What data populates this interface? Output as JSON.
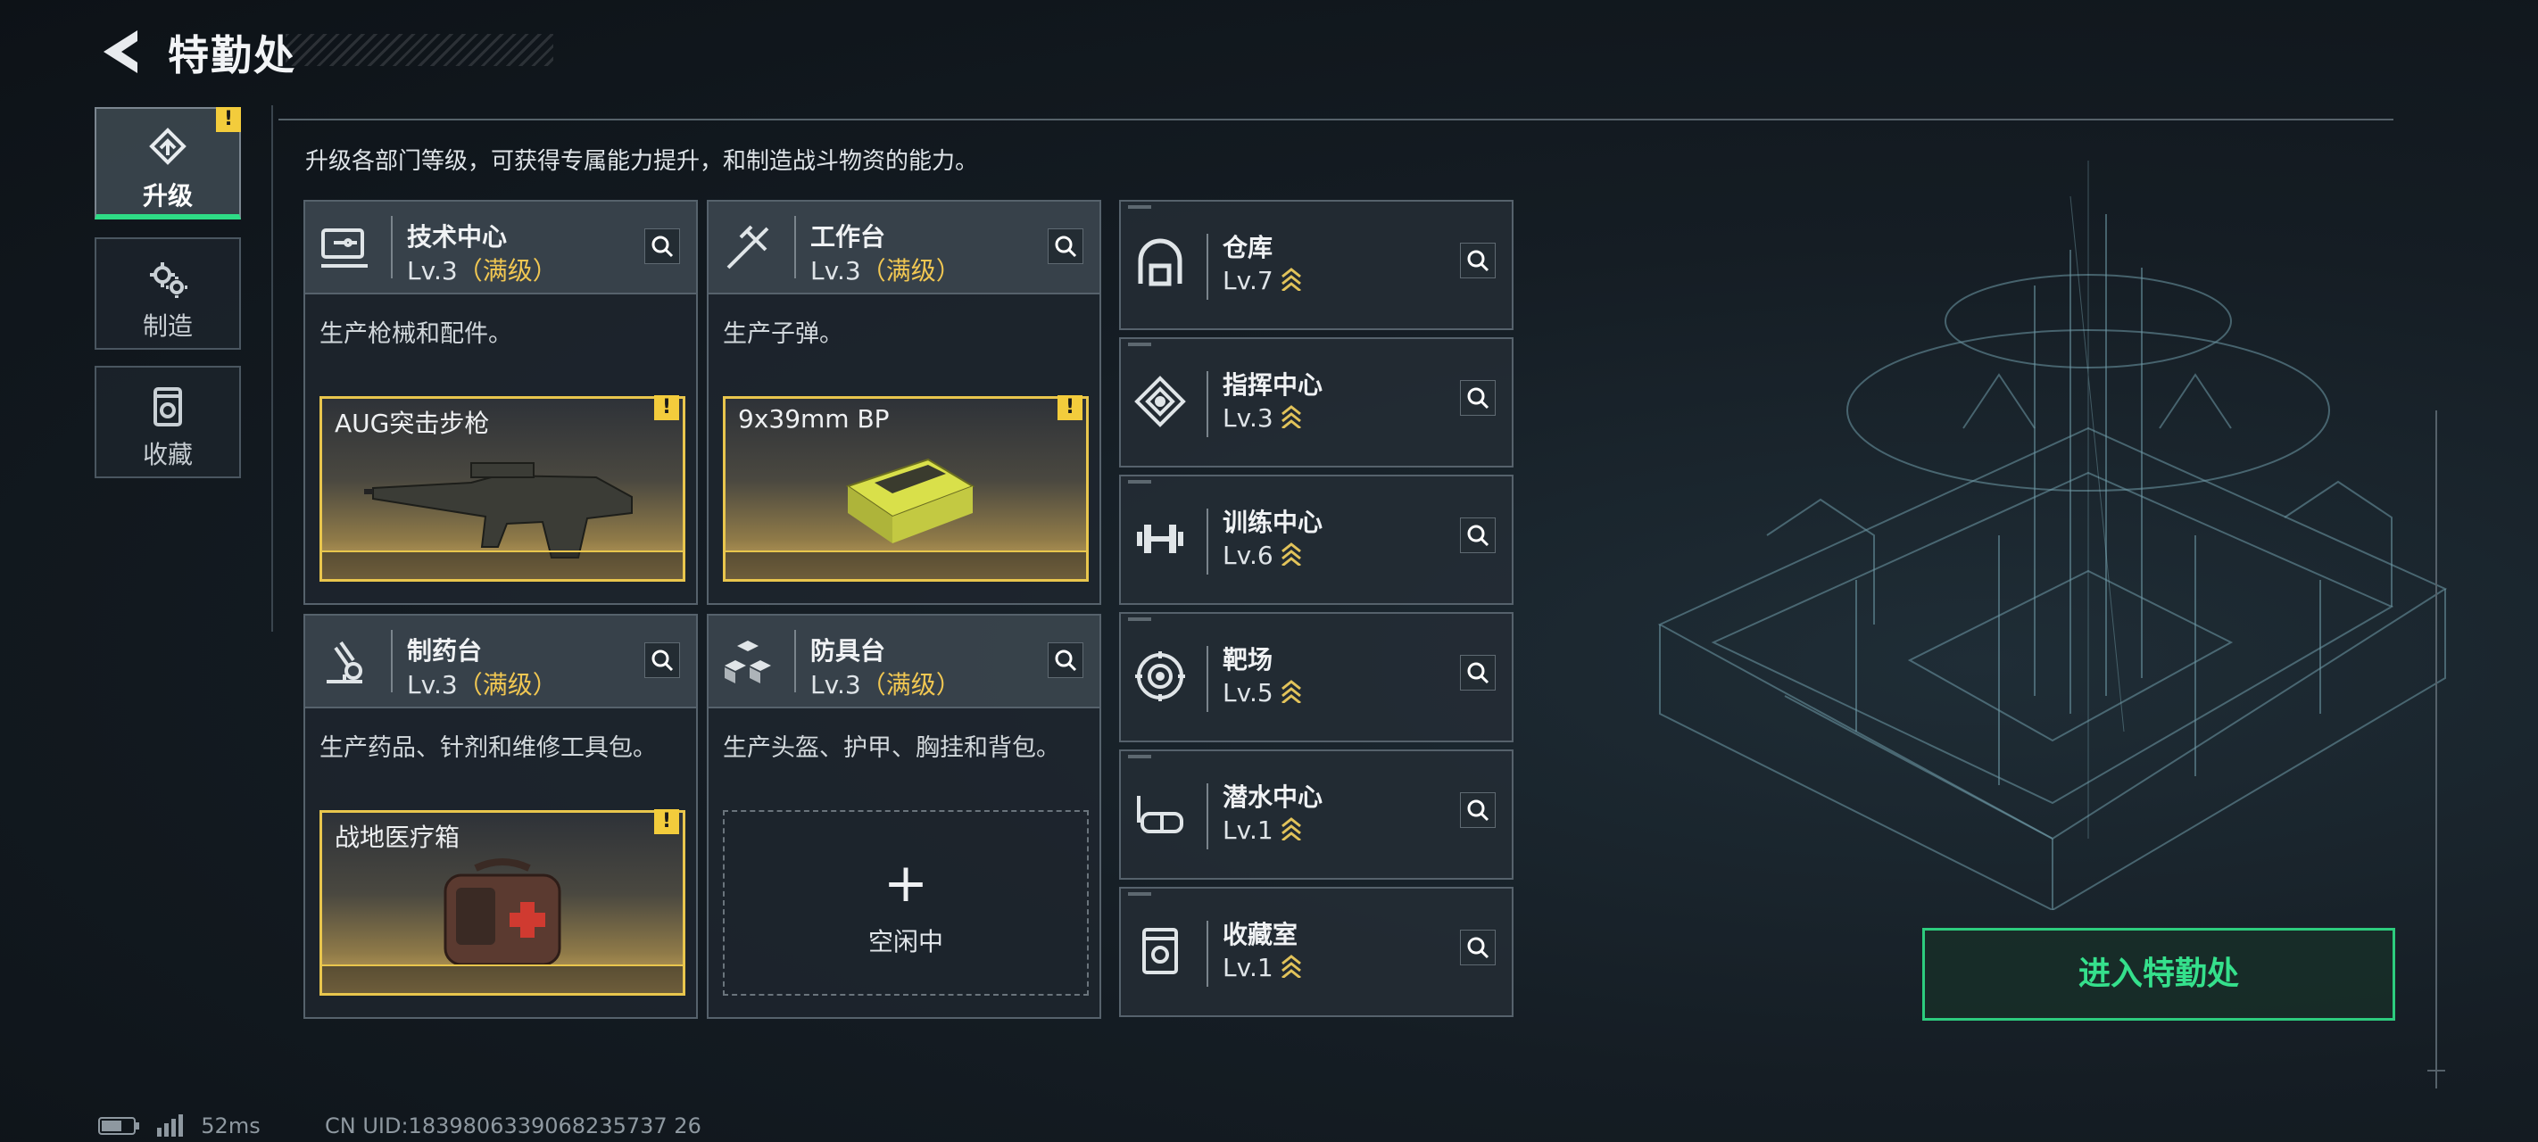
{
  "header": {
    "title": "特勤处"
  },
  "sidebar": {
    "tabs": [
      {
        "label": "升级",
        "icon": "upgrade-icon",
        "active": true
      },
      {
        "label": "制造",
        "icon": "gears-icon",
        "active": false
      },
      {
        "label": "收藏",
        "icon": "collection-icon",
        "active": false
      }
    ],
    "warning": "!"
  },
  "intro": "升级各部门等级，可获得专属能力提升，和制造战斗物资的能力。",
  "cards": [
    {
      "name": "技术中心",
      "level": "Lv.3",
      "max": "（满级）",
      "desc": "生产枪械和配件。",
      "product": "AUG突击步枪",
      "icon": "workstation-icon"
    },
    {
      "name": "工作台",
      "level": "Lv.3",
      "max": "（满级）",
      "desc": "生产子弹。",
      "product": "9x39mm BP",
      "icon": "tools-icon"
    },
    {
      "name": "制药台",
      "level": "Lv.3",
      "max": "（满级）",
      "desc": "生产药品、针剂和维修工具包。",
      "product": "战地医疗箱",
      "icon": "microscope-icon"
    },
    {
      "name": "防具台",
      "level": "Lv.3",
      "max": "（满级）",
      "desc": "生产头盔、护甲、胸挂和背包。",
      "idle_label": "空闲中",
      "idle_plus": "+",
      "icon": "cubes-icon"
    }
  ],
  "facilities": [
    {
      "name": "仓库",
      "level": "Lv.7",
      "icon": "warehouse-icon"
    },
    {
      "name": "指挥中心",
      "level": "Lv.3",
      "icon": "command-icon"
    },
    {
      "name": "训练中心",
      "level": "Lv.6",
      "icon": "dumbbell-icon"
    },
    {
      "name": "靶场",
      "level": "Lv.5",
      "icon": "target-icon"
    },
    {
      "name": "潜水中心",
      "level": "Lv.1",
      "icon": "goggles-icon"
    },
    {
      "name": "收藏室",
      "level": "Lv.1",
      "icon": "collection-icon"
    }
  ],
  "enter_button": "进入特勤处",
  "footer": {
    "ping": "52ms",
    "uid": "CN UID:1839806339068235737 26"
  },
  "colors": {
    "accent": "#2edc86",
    "gold": "#f1c752",
    "warning": "#f3cc3c"
  }
}
